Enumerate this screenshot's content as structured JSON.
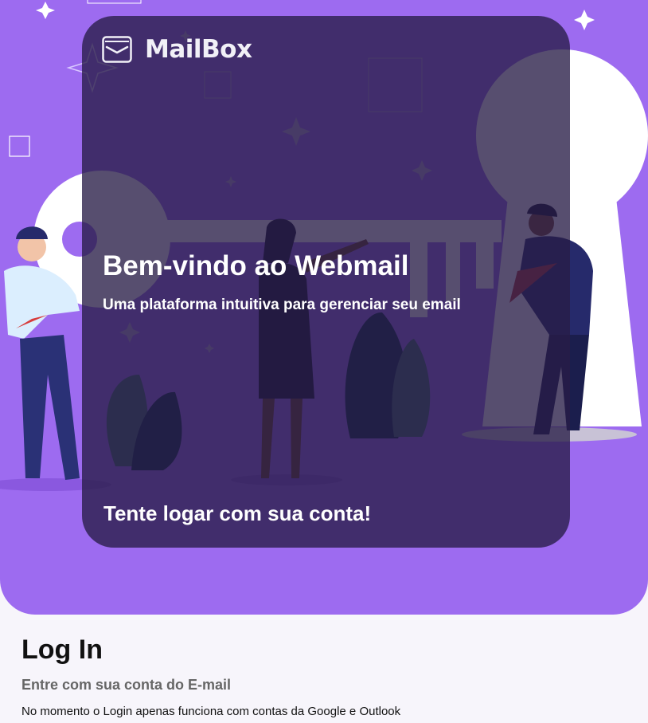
{
  "brand": {
    "name": "MailBox",
    "icon": "mail-envelope-icon"
  },
  "hero": {
    "title": "Bem-vindo ao Webmail",
    "subtitle": "Uma plataforma intuitiva para gerenciar seu email",
    "cta_text": "Tente logar com sua conta!",
    "illustration": "people-carrying-giant-key-to-keyhole"
  },
  "login": {
    "title": "Log In",
    "subtitle": "Entre com sua conta do E-mail",
    "note": "No momento o Login apenas funciona com contas da Google e Outlook"
  },
  "colors": {
    "hero_background": "#9d6bf0",
    "card_overlay": "#281c46",
    "page_background": "#f7f5fb",
    "text_light": "#ffffff",
    "text_dark": "#111111",
    "text_muted": "#666666"
  }
}
